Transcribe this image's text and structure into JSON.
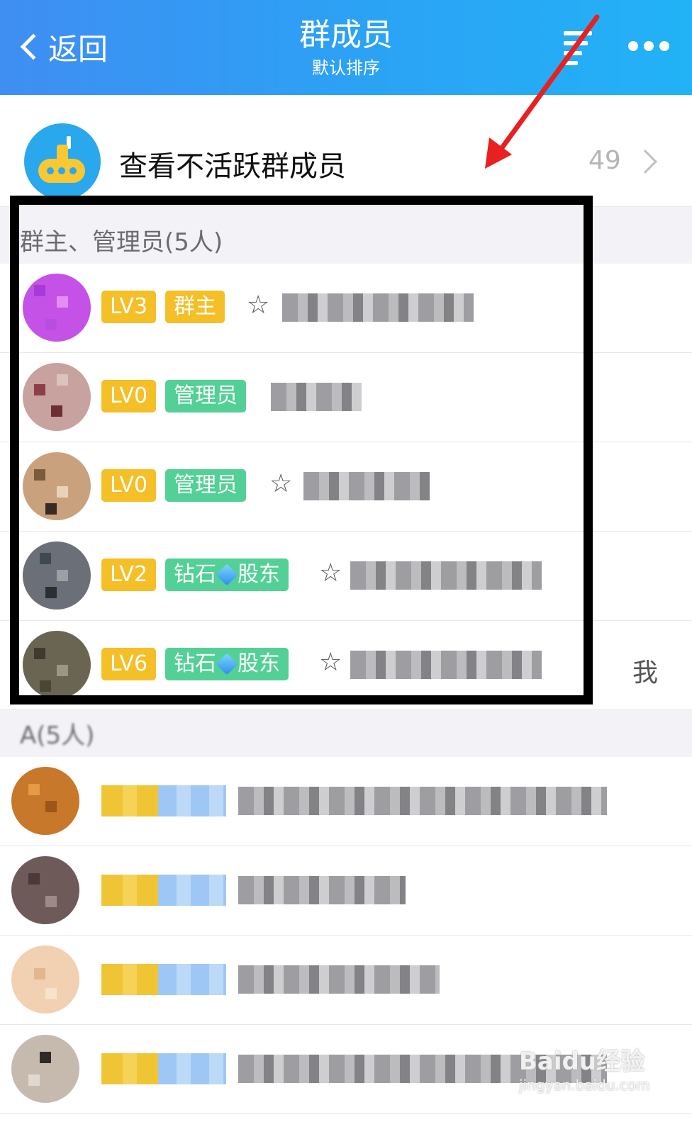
{
  "header": {
    "back_label": "返回",
    "title": "群成员",
    "subtitle": "默认排序"
  },
  "inactive": {
    "label": "查看不活跃群成员",
    "count": "49"
  },
  "sections": {
    "admins": "群主、管理员(5人)",
    "a_group": "A(5人)"
  },
  "admins": [
    {
      "level": "LV3",
      "role": "群主",
      "starred": true
    },
    {
      "level": "LV0",
      "role": "管理员",
      "starred": false
    },
    {
      "level": "LV0",
      "role": "管理员",
      "starred": true
    },
    {
      "level": "LV2",
      "role_pre": "钻石",
      "role_post": "股东",
      "starred": true
    },
    {
      "level": "LV6",
      "role_pre": "钻石",
      "role_post": "股东",
      "starred": true,
      "me": "我"
    }
  ],
  "star_glyph": "☆",
  "icons": [
    "back-chevron-icon",
    "sort-icon",
    "more-icon",
    "submarine-icon",
    "chevron-right-icon",
    "star-icon",
    "diamond-icon"
  ],
  "colors": {
    "header": "#3f8ef2",
    "level_badge": "#f4bf27",
    "admin_badge": "#53d095",
    "highlight_box": "#000000",
    "arrow": "#e8201f"
  },
  "watermark": {
    "brand": "Baidu经验",
    "url": "jingyan.baidu.com"
  }
}
